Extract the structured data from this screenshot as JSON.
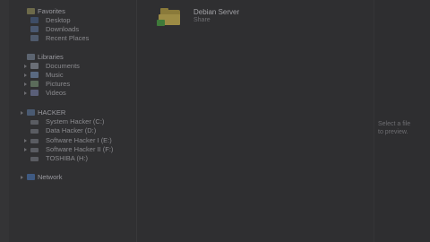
{
  "sidebar": {
    "favorites": {
      "header": "Favorites",
      "items": [
        "Desktop",
        "Downloads",
        "Recent Places"
      ]
    },
    "libraries": {
      "header": "Libraries",
      "items": [
        "Documents",
        "Music",
        "Pictures",
        "Videos"
      ]
    },
    "computer": {
      "header": "HACKER",
      "items": [
        "System Hacker (C:)",
        "Data Hacker (D:)",
        "Software Hacker I (E:)",
        "Software Hacker II (F:)",
        "TOSHIBA (H:)"
      ]
    },
    "network": {
      "header": "Network"
    }
  },
  "content": {
    "item": {
      "name": "Debian Server",
      "subtitle": "Share"
    }
  },
  "preview": {
    "line1": "Select a file",
    "line2": "to preview."
  }
}
